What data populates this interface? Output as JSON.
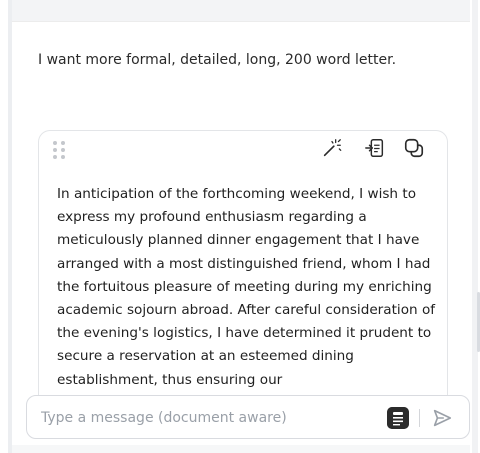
{
  "user_message": {
    "text": "I want more formal, detailed, long, 200 word letter."
  },
  "response_card": {
    "toolbar": {
      "icons": [
        "magic-wand-icon",
        "export-icon",
        "copy-icon"
      ]
    },
    "body": "In anticipation of the forthcoming weekend, I wish to express my profound enthusiasm regarding a meticulously planned dinner engagement that I have arranged with a most distinguished friend, whom I had the fortuitous pleasure of meeting during my enriching academic sojourn abroad. After careful consideration of the evening's logistics, I have determined it prudent to secure a reservation at an esteemed dining establishment, thus ensuring our"
  },
  "composer": {
    "placeholder": "Type a message (document aware)",
    "value": "",
    "icons": [
      "document-aware-icon",
      "send-icon"
    ]
  },
  "colors": {
    "background": "#ffffff",
    "card_border": "#e3e5e8",
    "placeholder": "#9aa0a8",
    "send_icon": "#9aa0a8",
    "doc_button": "#2b2b2b"
  }
}
